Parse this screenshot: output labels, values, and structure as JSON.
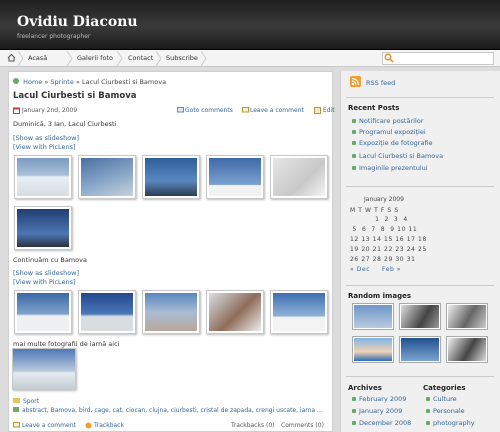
{
  "header": {
    "site_title": "Ovidiu Diaconu",
    "tagline": "freelancer photographer"
  },
  "nav": {
    "home_icon": "home-icon",
    "items": [
      "Acasă",
      "Galerii foto",
      "Contact",
      "Subscribe"
    ]
  },
  "breadcrumb": {
    "home": "Home",
    "sep1": "»",
    "category": "Sprinte",
    "sep2": "»",
    "current": "Lacul Ciurbesti si Bamova"
  },
  "post": {
    "title": "Lacul Ciurbesti si Bamova",
    "date": "January 2nd, 2009",
    "goto_comments": "Goto comments",
    "leave_comment": "Leave a comment",
    "edit": "Edit",
    "intro": "Duminică, 3 Ian, Lacul Ciurbesti",
    "slideshow1": "[Show as slideshow]",
    "flickr1": "[View with PicLens]",
    "caption2": "Continuăm cu Bamova",
    "slideshow2": "[Show as slideshow]",
    "flickr2": "[View with PicLens]",
    "more_photos": "mai multe fotografii de iarnă aici",
    "tag_label": "Sport",
    "tags": "abstract, Bamova, bird, cage, cat, ciocan, clujna, ciurbesti, cristal de zapada, crengi uscate, iarna ...",
    "footer_leave": "Leave a comment",
    "footer_trackback": "Trackback",
    "footer_trackbacks_count": "Trackbacks (0)",
    "footer_comments_count": "Comments (0)"
  },
  "sidebar": {
    "rss_label": "RSS feed",
    "recent_heading": "Recent Posts",
    "recent": [
      "Notificare postărilor",
      "Programul expoziției",
      "Expoziție de fotografie",
      "Lacul Ciurbesti si Bamova",
      "Imaginile prezentului"
    ],
    "calendar": {
      "month": "January 2009",
      "header": "M T W T F S S",
      "rows": [
        "          1  2  3  4",
        " 5  6  7  8  9 10 11",
        "12 13 14 15 16 17 18",
        "19 20 21 22 23 24 25",
        "26 27 28 29 30 31"
      ],
      "prev": "« Dec",
      "next": "Feb »"
    },
    "random_heading": "Random images",
    "archives_heading": "Archives",
    "archives": [
      "February 2009",
      "January 2009",
      "December 2008"
    ],
    "categories_heading": "Categories",
    "categories": [
      "Culture",
      "Personale",
      "photography"
    ]
  },
  "colors": {
    "header_bg": "#2b2b2b",
    "link": "#336699",
    "rss": "#f39c2b",
    "bullet": "#66aa66"
  }
}
